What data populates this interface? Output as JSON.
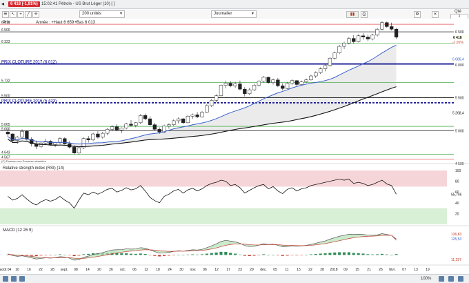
{
  "window": {
    "price_badge": "6 418 (-1,91%)",
    "title": "15:02:41 Pétrole - US Brut Léger (10) [ ]"
  },
  "toolbar": {
    "units_value": "200 unités",
    "period_value": "Journalier"
  },
  "side_panel": {
    "qty_label": "Qté",
    "qty_value": "1"
  },
  "icons": {
    "back": "back-icon",
    "menu": "menu-icon",
    "cursor": "cursor-icon",
    "plus": "plus-icon",
    "line_tool": "line-tool-icon",
    "cross": "crosshair-icon",
    "candles": "candles-icon",
    "print": "print-icon",
    "settings": "gear-icon",
    "close": "close-icon"
  },
  "status_bar": {
    "zoom_text": "100%"
  },
  "colors": {
    "up_candle": "#ffffff",
    "down_candle": "#222222",
    "ma_blue": "#3a5fcd",
    "ma_black": "#111111",
    "level_green": "#4caf50",
    "level_red": "#e05050",
    "level_blue": "#00008b",
    "rsi_line": "#111111",
    "macd_green": "#2e8b57",
    "macd_red": "#c0392b",
    "overbought": "#f6d5d9",
    "oversold": "#d8f0d6"
  },
  "chart_data": [
    {
      "type": "candlestick",
      "title": "Prix",
      "subtitle": "Année : +Haut 6 659 •Bas 6 013",
      "source": "(C) Finance.com Données retardées",
      "last_price": "6 418",
      "last_change": "-1,91%",
      "ylim": [
        4500,
        6700
      ],
      "yticks": [
        4500,
        5000,
        5500,
        6000,
        6500
      ],
      "ytick_labels": [
        "4 500",
        "5 000",
        "5 500",
        "6 000",
        "6 500"
      ],
      "level_labels": [
        {
          "value": 6615,
          "label": "6 615",
          "color": "#e05050"
        },
        {
          "value": 6500,
          "label": "6 500",
          "color": "#111111"
        },
        {
          "value": 6323,
          "label": "6 323",
          "color": "#4caf50"
        },
        {
          "value": 6012,
          "label": "PRIX CLOTURE 2017 (6 012)",
          "color": "#00008b"
        },
        {
          "value": 5732,
          "label": "5 732",
          "color": "#4caf50"
        },
        {
          "value": 5500,
          "label": "5 500",
          "color": "#111111"
        },
        {
          "value": 5423,
          "label": "PRIX CLOTURE 2016 (5 423)",
          "color": "#00008b"
        },
        {
          "value": 5065,
          "label": "5 065",
          "color": "#4caf50"
        },
        {
          "value": 5000,
          "label": "5 000",
          "color": "#111111"
        },
        {
          "value": 4643,
          "label": "4 643",
          "color": "#4caf50"
        },
        {
          "value": 4567,
          "label": "4 567",
          "color": "#e05050"
        }
      ],
      "ma_labels": [
        {
          "value": 6086,
          "label": "6 086,4",
          "color": "#3a5fcd"
        },
        {
          "value": 5268,
          "label": "5 268,4",
          "color": "#111111"
        }
      ],
      "x_labels": [
        "août 04",
        "10",
        "16",
        "22",
        "28",
        "sept.",
        "08",
        "14",
        "20",
        "26",
        "oct.",
        "06",
        "12",
        "18",
        "24",
        "30",
        "nov.",
        "06",
        "12",
        "17",
        "23",
        "29",
        "déc.",
        "05",
        "11",
        "15",
        "22",
        "28",
        "2018",
        "09",
        "15",
        "21",
        "26",
        "févr.",
        "07",
        "13",
        "19"
      ],
      "candles": [
        [
          4980,
          5030,
          4900,
          4950
        ],
        [
          4950,
          4960,
          4820,
          4850
        ],
        [
          4850,
          4920,
          4800,
          4900
        ],
        [
          4900,
          5020,
          4880,
          4990
        ],
        [
          4990,
          5010,
          4850,
          4870
        ],
        [
          4870,
          4900,
          4760,
          4800
        ],
        [
          4800,
          4850,
          4720,
          4760
        ],
        [
          4760,
          4830,
          4740,
          4810
        ],
        [
          4810,
          4880,
          4780,
          4840
        ],
        [
          4840,
          4860,
          4770,
          4790
        ],
        [
          4790,
          4830,
          4750,
          4820
        ],
        [
          4820,
          4900,
          4800,
          4880
        ],
        [
          4880,
          4900,
          4790,
          4800
        ],
        [
          4800,
          4840,
          4730,
          4750
        ],
        [
          4750,
          4780,
          4640,
          4660
        ],
        [
          4660,
          4760,
          4630,
          4740
        ],
        [
          4740,
          4900,
          4720,
          4880
        ],
        [
          4880,
          4920,
          4820,
          4860
        ],
        [
          4860,
          4970,
          4840,
          4950
        ],
        [
          4950,
          4990,
          4880,
          4900
        ],
        [
          4900,
          4980,
          4880,
          4960
        ],
        [
          4960,
          5040,
          4930,
          5020
        ],
        [
          5020,
          5080,
          4990,
          5060
        ],
        [
          5060,
          5100,
          4990,
          5010
        ],
        [
          5010,
          5050,
          4960,
          5040
        ],
        [
          5040,
          5120,
          5020,
          5100
        ],
        [
          5100,
          5160,
          5060,
          5080
        ],
        [
          5080,
          5130,
          5050,
          5120
        ],
        [
          5120,
          5250,
          5100,
          5230
        ],
        [
          5230,
          5260,
          5160,
          5180
        ],
        [
          5180,
          5220,
          5070,
          5090
        ],
        [
          5090,
          5120,
          5000,
          5020
        ],
        [
          5020,
          5050,
          4950,
          4980
        ],
        [
          4980,
          5090,
          4960,
          5070
        ],
        [
          5070,
          5110,
          5030,
          5090
        ],
        [
          5090,
          5170,
          5070,
          5150
        ],
        [
          5150,
          5200,
          5110,
          5180
        ],
        [
          5180,
          5190,
          5100,
          5120
        ],
        [
          5120,
          5240,
          5110,
          5220
        ],
        [
          5220,
          5260,
          5180,
          5240
        ],
        [
          5240,
          5280,
          5190,
          5210
        ],
        [
          5210,
          5300,
          5200,
          5280
        ],
        [
          5280,
          5400,
          5270,
          5380
        ],
        [
          5380,
          5480,
          5360,
          5460
        ],
        [
          5460,
          5550,
          5430,
          5530
        ],
        [
          5530,
          5700,
          5520,
          5690
        ],
        [
          5690,
          5760,
          5640,
          5720
        ],
        [
          5720,
          5750,
          5660,
          5680
        ],
        [
          5680,
          5740,
          5650,
          5710
        ],
        [
          5710,
          5760,
          5610,
          5630
        ],
        [
          5630,
          5660,
          5520,
          5560
        ],
        [
          5560,
          5650,
          5540,
          5620
        ],
        [
          5620,
          5710,
          5600,
          5690
        ],
        [
          5690,
          5770,
          5670,
          5750
        ],
        [
          5750,
          5830,
          5730,
          5810
        ],
        [
          5810,
          5820,
          5710,
          5730
        ],
        [
          5730,
          5790,
          5700,
          5770
        ],
        [
          5770,
          5800,
          5660,
          5680
        ],
        [
          5680,
          5720,
          5610,
          5640
        ],
        [
          5640,
          5740,
          5630,
          5720
        ],
        [
          5720,
          5780,
          5690,
          5760
        ],
        [
          5760,
          5770,
          5680,
          5700
        ],
        [
          5700,
          5760,
          5690,
          5740
        ],
        [
          5740,
          5790,
          5720,
          5770
        ],
        [
          5770,
          5850,
          5760,
          5830
        ],
        [
          5830,
          5900,
          5800,
          5880
        ],
        [
          5880,
          5960,
          5860,
          5940
        ],
        [
          5940,
          6010,
          5900,
          5990
        ],
        [
          5990,
          6120,
          5970,
          6100
        ],
        [
          6100,
          6200,
          6080,
          6180
        ],
        [
          6180,
          6300,
          6160,
          6280
        ],
        [
          6280,
          6350,
          6240,
          6330
        ],
        [
          6330,
          6420,
          6310,
          6400
        ],
        [
          6400,
          6450,
          6320,
          6350
        ],
        [
          6350,
          6460,
          6340,
          6440
        ],
        [
          6440,
          6480,
          6380,
          6420
        ],
        [
          6420,
          6460,
          6360,
          6390
        ],
        [
          6390,
          6470,
          6370,
          6450
        ],
        [
          6450,
          6560,
          6430,
          6540
        ],
        [
          6540,
          6659,
          6520,
          6640
        ],
        [
          6640,
          6655,
          6560,
          6580
        ],
        [
          6580,
          6640,
          6520,
          6540
        ],
        [
          6540,
          6560,
          6390,
          6418
        ]
      ]
    },
    {
      "type": "line",
      "title": "Relative strength index (RSI) (14)",
      "ylim": [
        0,
        100
      ],
      "yticks": [
        20,
        40,
        60,
        80,
        100
      ],
      "last_label": "55,746",
      "zones": {
        "overbought": 70,
        "oversold": 30
      },
      "values": [
        52,
        45,
        48,
        55,
        47,
        40,
        36,
        42,
        46,
        43,
        46,
        52,
        45,
        40,
        30,
        45,
        58,
        55,
        60,
        56,
        60,
        65,
        67,
        60,
        63,
        68,
        64,
        66,
        72,
        62,
        50,
        44,
        40,
        52,
        56,
        62,
        65,
        58,
        64,
        67,
        62,
        66,
        72,
        76,
        78,
        82,
        80,
        72,
        74,
        68,
        58,
        63,
        68,
        72,
        74,
        66,
        70,
        62,
        57,
        65,
        68,
        62,
        66,
        68,
        72,
        74,
        76,
        78,
        80,
        82,
        84,
        82,
        84,
        76,
        78,
        76,
        72,
        74,
        78,
        82,
        75,
        72,
        56
      ]
    },
    {
      "type": "macd",
      "title": "MACD (12 26 9)",
      "last_labels": [
        "136,83",
        "125,53",
        "11,297"
      ],
      "macd": [
        10,
        -5,
        -12,
        -8,
        -15,
        -25,
        -35,
        -30,
        -25,
        -28,
        -24,
        -15,
        -18,
        -28,
        -45,
        -40,
        -20,
        -10,
        5,
        10,
        20,
        32,
        42,
        45,
        46,
        52,
        50,
        52,
        62,
        58,
        42,
        28,
        15,
        18,
        22,
        30,
        36,
        32,
        38,
        44,
        42,
        48,
        62,
        78,
        95,
        115,
        125,
        118,
        112,
        100,
        80,
        72,
        74,
        84,
        96,
        90,
        92,
        82,
        70,
        72,
        78,
        74,
        78,
        82,
        90,
        100,
        110,
        120,
        135,
        148,
        160,
        168,
        178,
        175,
        178,
        176,
        170,
        168,
        172,
        182,
        175,
        168,
        136.83
      ],
      "signal": [
        5,
        2,
        -2,
        -5,
        -8,
        -12,
        -18,
        -22,
        -24,
        -25,
        -25,
        -23,
        -22,
        -23,
        -28,
        -31,
        -29,
        -25,
        -19,
        -13,
        -6,
        2,
        10,
        17,
        23,
        29,
        33,
        37,
        42,
        45,
        44,
        41,
        36,
        33,
        31,
        31,
        32,
        32,
        33,
        36,
        37,
        39,
        44,
        51,
        60,
        71,
        82,
        89,
        94,
        95,
        92,
        88,
        85,
        85,
        87,
        88,
        89,
        88,
        84,
        82,
        81,
        80,
        79,
        80,
        82,
        86,
        91,
        97,
        105,
        113,
        122,
        131,
        140,
        147,
        153,
        157,
        160,
        161,
        163,
        167,
        168,
        168,
        125.53
      ]
    }
  ]
}
